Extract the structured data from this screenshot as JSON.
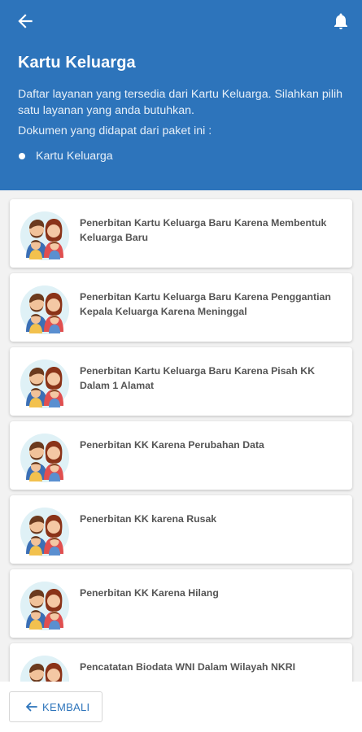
{
  "header": {
    "title": "Kartu Keluarga",
    "description": "Daftar layanan yang tersedia dari Kartu Keluarga. Silahkan pilih satu layanan yang anda butuhkan.",
    "documents_label": "Dokumen yang didapat dari paket ini :",
    "documents": [
      "Kartu Keluarga"
    ],
    "background_color": "#2d74bb",
    "back_icon": "arrow-left-icon",
    "notification_icon": "bell-icon"
  },
  "services": [
    {
      "label": "Penerbitan Kartu Keluarga Baru Karena Membentuk Keluarga Baru",
      "icon": "family-icon"
    },
    {
      "label": "Penerbitan Kartu Keluarga Baru Karena Penggantian Kepala Keluarga Karena Meninggal",
      "icon": "family-icon"
    },
    {
      "label": "Penerbitan Kartu Keluarga Baru Karena Pisah KK Dalam 1 Alamat",
      "icon": "family-icon"
    },
    {
      "label": "Penerbitan KK Karena Perubahan Data",
      "icon": "family-icon"
    },
    {
      "label": "Penerbitan KK karena Rusak",
      "icon": "family-icon"
    },
    {
      "label": "Penerbitan KK Karena Hilang",
      "icon": "family-icon"
    },
    {
      "label": "Pencatatan Biodata WNI Dalam Wilayah NKRI",
      "icon": "family-icon"
    }
  ],
  "footer": {
    "back_label": "KEMBALI",
    "back_icon": "arrow-left-icon",
    "accent_color": "#2d74bb"
  }
}
